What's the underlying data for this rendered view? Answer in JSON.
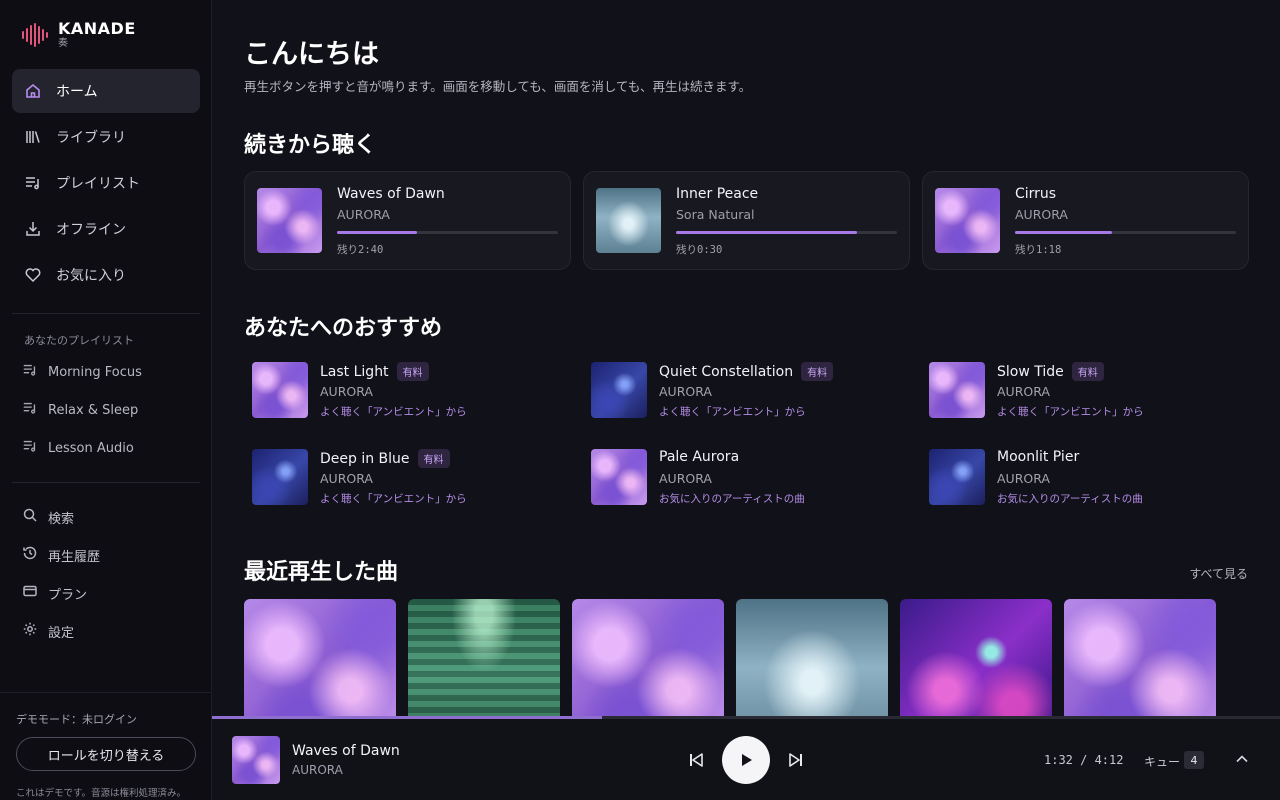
{
  "brand": {
    "name": "KANADE",
    "sub": "奏",
    "accent": "#e2557b"
  },
  "nav": [
    {
      "label": "ホーム",
      "icon": "home-icon",
      "active": true
    },
    {
      "label": "ライブラリ",
      "icon": "library-icon"
    },
    {
      "label": "プレイリスト",
      "icon": "playlist-icon"
    },
    {
      "label": "オフライン",
      "icon": "download-icon"
    },
    {
      "label": "お気に入り",
      "icon": "heart-icon"
    }
  ],
  "playlists": {
    "title": "あなたのプレイリスト",
    "items": [
      "Morning Focus",
      "Relax & Sleep",
      "Lesson Audio"
    ]
  },
  "utility": [
    {
      "label": "検索",
      "icon": "search-icon"
    },
    {
      "label": "再生履歴",
      "icon": "history-icon"
    },
    {
      "label": "プラン",
      "icon": "card-icon"
    },
    {
      "label": "設定",
      "icon": "gear-icon"
    }
  ],
  "footer": {
    "demo_mode": "デモモード：未ログイン",
    "role_button": "ロールを切り替える",
    "note": "これはデモです。音源は権利処理済み。"
  },
  "greeting": {
    "title": "こんにちは",
    "subtitle": "再生ボタンを押すと音が鳴ります。画面を移動しても、画面を消しても、再生は続きます。"
  },
  "continue": {
    "title": "続きから聴く",
    "items": [
      {
        "title": "Waves of Dawn",
        "artist": "AURORA",
        "remaining": "残り2:40",
        "progress": 0.36,
        "art": "aurora"
      },
      {
        "title": "Inner Peace",
        "artist": "Sora Natural",
        "remaining": "残り0:30",
        "progress": 0.82,
        "art": "peace"
      },
      {
        "title": "Cirrus",
        "artist": "AURORA",
        "remaining": "残り1:18",
        "progress": 0.44,
        "art": "aurora"
      }
    ]
  },
  "recommend": {
    "title": "あなたへのおすすめ",
    "items": [
      {
        "title": "Last Light",
        "artist": "AURORA",
        "reason": "よく聴く「アンビエント」から",
        "badge": "有料",
        "art": "aurora"
      },
      {
        "title": "Quiet Constellation",
        "artist": "AURORA",
        "reason": "よく聴く「アンビエント」から",
        "badge": "有料",
        "art": "blue"
      },
      {
        "title": "Slow Tide",
        "artist": "AURORA",
        "reason": "よく聴く「アンビエント」から",
        "badge": "有料",
        "art": "aurora"
      },
      {
        "title": "Deep in Blue",
        "artist": "AURORA",
        "reason": "よく聴く「アンビエント」から",
        "badge": "有料",
        "art": "blue"
      },
      {
        "title": "Pale Aurora",
        "artist": "AURORA",
        "reason": "お気に入りのアーティストの曲",
        "badge": "",
        "art": "aurora"
      },
      {
        "title": "Moonlit Pier",
        "artist": "AURORA",
        "reason": "お気に入りのアーティストの曲",
        "badge": "",
        "art": "blue"
      }
    ]
  },
  "recent": {
    "title": "最近再生した曲",
    "see_all": "すべて見る",
    "tiles": [
      "aurora",
      "green",
      "aurora",
      "peace",
      "fire",
      "aurora"
    ]
  },
  "player": {
    "title": "Waves of Dawn",
    "artist": "AURORA",
    "time": "1:32 / 4:12",
    "queue_label": "キュー",
    "queue_count": "4",
    "progress": 0.365
  }
}
